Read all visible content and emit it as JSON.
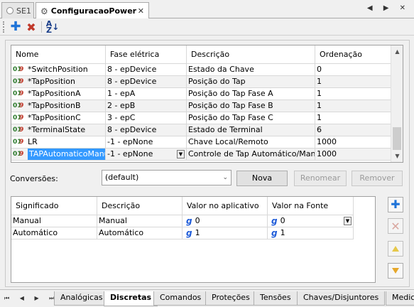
{
  "doc_tabs": [
    {
      "label": "SE1",
      "active": false
    },
    {
      "label": "ConfiguracaoPower",
      "active": true
    }
  ],
  "nav_arrows": "◀ ▶ ✕",
  "grid": {
    "columns": [
      "Nome",
      "Fase elétrica",
      "Descrição",
      "Ordenação"
    ],
    "rows": [
      {
        "name": "*SwitchPosition",
        "phase": "8 - epDevice",
        "desc": "Estado da Chave",
        "order": "0"
      },
      {
        "name": "*TapPosition",
        "phase": "8 - epDevice",
        "desc": "Posição do Tap",
        "order": "1"
      },
      {
        "name": "*TapPositionA",
        "phase": "1 - epA",
        "desc": "Posição do Tap Fase A",
        "order": "1"
      },
      {
        "name": "*TapPositionB",
        "phase": "2 - epB",
        "desc": "Posição do Tap Fase B",
        "order": "1"
      },
      {
        "name": "*TapPositionC",
        "phase": "3 - epC",
        "desc": "Posição do Tap Fase C",
        "order": "1"
      },
      {
        "name": "*TerminalState",
        "phase": "8 - epDevice",
        "desc": "Estado de Terminal",
        "order": "6"
      },
      {
        "name": "LR",
        "phase": "-1 - epNone",
        "desc": "Chave Local/Remoto",
        "order": "1000"
      },
      {
        "name": "TAPAutomaticoManual",
        "phase": "-1 - epNone",
        "desc": "Controle de Tap Automático/Manual",
        "order": "1000",
        "selected": true
      }
    ]
  },
  "conversions": {
    "label": "Conversões:",
    "selected": "(default)",
    "buttons": {
      "nova": "Nova",
      "renomear": "Renomear",
      "remover": "Remover"
    }
  },
  "conv_grid": {
    "columns": [
      "Significado",
      "Descrição",
      "Valor no aplicativo",
      "Valor na Fonte"
    ],
    "rows": [
      {
        "significado": "Manual",
        "descricao": "Manual",
        "app": "0",
        "fonte": "0"
      },
      {
        "significado": "Automático",
        "descricao": "Automático",
        "app": "1",
        "fonte": "1"
      }
    ],
    "value_icon": "g"
  },
  "bottom_tabs": [
    "Analógicas",
    "Discretas",
    "Comandos",
    "Proteções",
    "Tensões",
    "Chaves/Disjuntores",
    "Medic"
  ],
  "bottom_active": "Discretas",
  "bottom_nav": "⏮ ◀ ▶ ⏭",
  "icons": {
    "add": "plus-icon",
    "delete": "x-icon",
    "sort": "sort-az-icon",
    "point_type": "digital-point-icon",
    "value": "g-icon"
  },
  "colors": {
    "selection": "#3399ff",
    "add": "#1e73d8",
    "delete": "#c0392b"
  }
}
